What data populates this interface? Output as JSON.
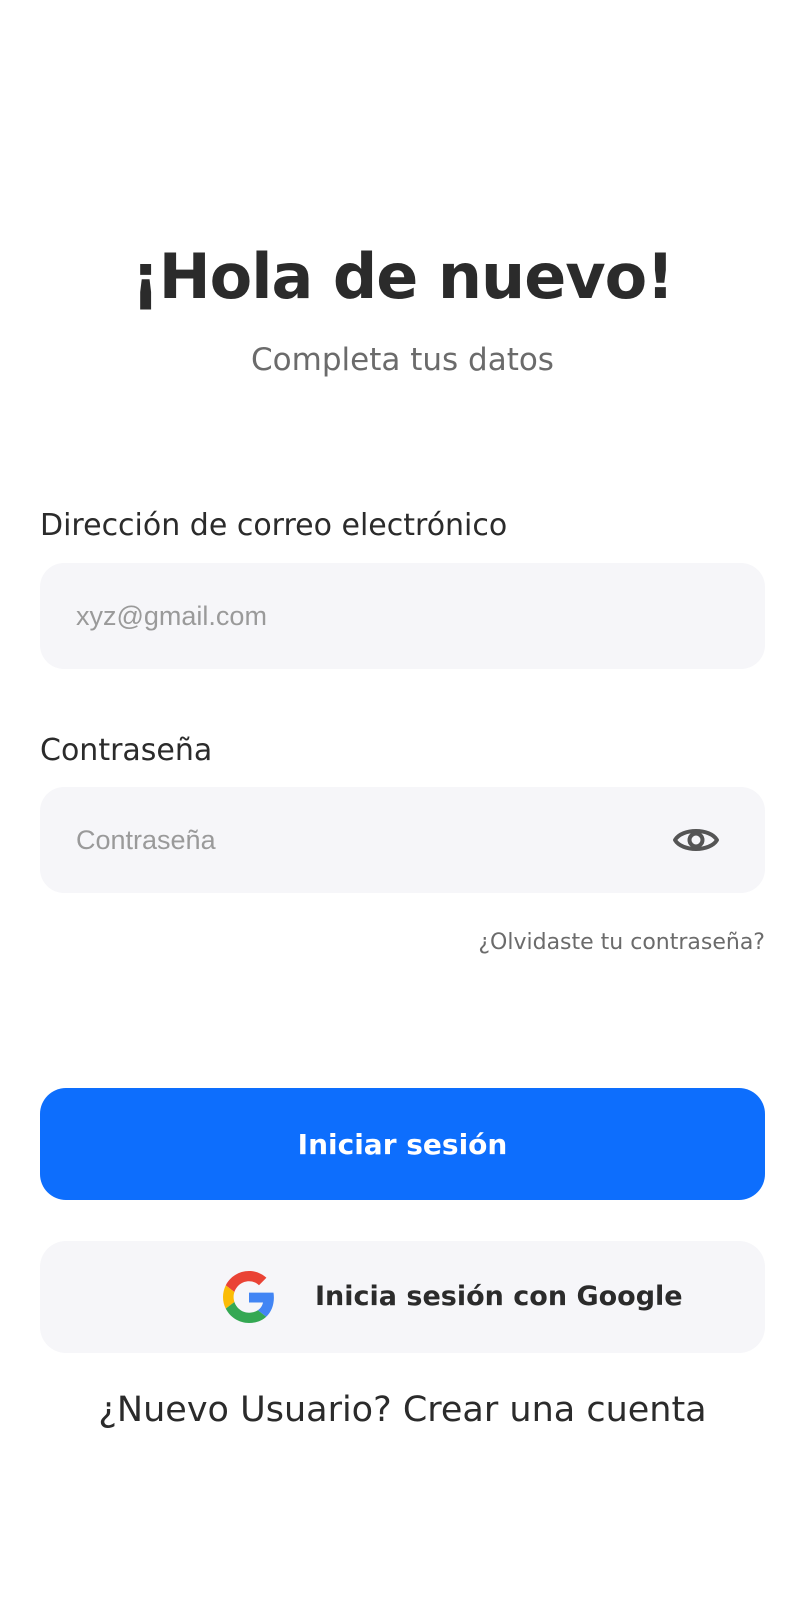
{
  "header": {
    "title": "¡Hola de nuevo!",
    "subtitle": "Completa tus datos"
  },
  "email": {
    "label": "Dirección de correo electrónico",
    "placeholder": "xyz@gmail.com",
    "value": ""
  },
  "password": {
    "label": "Contraseña",
    "placeholder": "Contraseña",
    "value": "",
    "toggle_icon": "eye-icon"
  },
  "forgot_password": "¿Olvidaste tu contraseña?",
  "login_button": "Iniciar sesión",
  "google_button": {
    "label": "Inicia sesión con Google",
    "icon": "google-icon"
  },
  "signup": {
    "prompt": "¿Nuevo Usuario?",
    "link": "Crear una cuenta"
  },
  "colors": {
    "primary": "#0d6efd",
    "field_bg": "#f6f6f9",
    "text": "#2b2b2b",
    "muted": "#6b6b6b"
  }
}
